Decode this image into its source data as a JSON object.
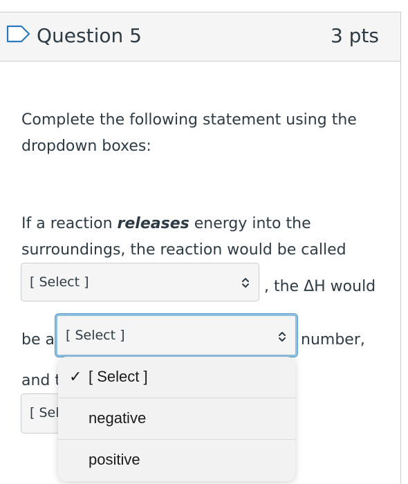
{
  "question": {
    "title": "Question 5",
    "points": "3 pts",
    "prompt": "Complete the following statement using the dropdown boxes:"
  },
  "statement": {
    "part1_before_bold": "If a reaction ",
    "part1_bold": "releases",
    "part1_after_bold": " energy into the",
    "line2": "surroundings, the reaction would be called",
    "after_select1": ", the ΔH would",
    "line4_start": "be a",
    "after_select2": "number,",
    "line5_start": "and t"
  },
  "selects": [
    {
      "label": "[ Select ]"
    },
    {
      "label": "[ Select ]"
    },
    {
      "label": "[ Sel"
    }
  ],
  "dropdown": {
    "options": [
      {
        "label": "[ Select ]",
        "checked": true,
        "check": "✓"
      },
      {
        "label": "negative",
        "checked": false,
        "check": ""
      },
      {
        "label": "positive",
        "checked": false,
        "check": ""
      }
    ]
  },
  "icons": {
    "flag": "flag-icon",
    "select_chevron": "chevron-up-down-icon",
    "checkmark": "check-icon"
  },
  "colors": {
    "text": "#2d3b45",
    "header_bg": "#f5f5f5",
    "border": "#c7cdd1",
    "focus_ring": "#8fbfdf",
    "flag_stroke": "#2b7abc"
  }
}
